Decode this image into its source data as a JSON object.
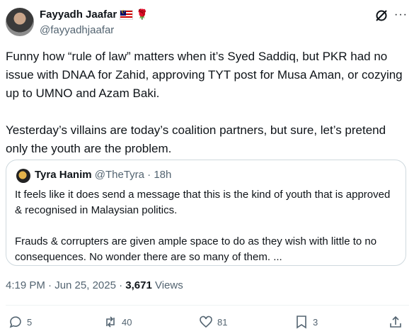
{
  "author": {
    "name": "Fayyadh Jaafar",
    "handle": "@fayyadhjaafar",
    "emojis": [
      "malaysia-flag",
      "rose"
    ]
  },
  "post": {
    "text": "Funny how “rule of law” matters when it’s Syed Saddiq, but PKR had no issue with DNAA for Zahid, approving TYT post for Musa Aman, or cozying up to UMNO and Azam Baki.\n\nYesterday’s villains are today’s coalition partners, but sure, let’s pretend only the youth are the problem.",
    "time": "4:19 PM · Jun 25, 2025 · ",
    "views_count": "3,671",
    "views_label": " Views"
  },
  "quote": {
    "name": "Tyra Hanim",
    "meta": " @TheTyra · 18h",
    "text": "It feels like it does send a message that this is the kind of youth that is approved & recognised in Malaysian politics.\n\nFrauds & corrupters are given ample space to do as they wish with little to no consequences. No wonder there are so many of them. ..."
  },
  "actions": {
    "replies": "5",
    "reposts": "40",
    "likes": "81",
    "bookmarks": "3"
  },
  "colors": {
    "text": "#0f1419",
    "secondary": "#536471",
    "border": "#cfd9de"
  },
  "icons": [
    "grok-icon",
    "more-icon",
    "reply-icon",
    "repost-icon",
    "like-icon",
    "bookmark-icon",
    "share-icon"
  ]
}
